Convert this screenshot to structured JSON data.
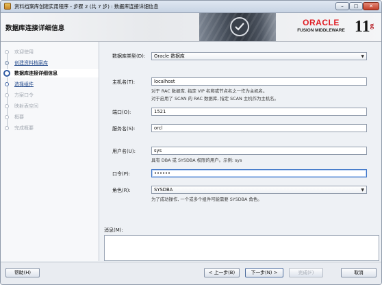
{
  "window": {
    "title": "资料档案库创建实用程序 - 步骤 2 (共 7 步) : 数据库连接详细信息",
    "controls": {
      "minimize": "–",
      "maximize": "□",
      "close": "✕"
    }
  },
  "header": {
    "page_title": "数据库连接详细信息",
    "brand": {
      "oracle": "ORACLE",
      "product": "FUSION MIDDLEWARE",
      "version": "11",
      "version_suffix": "g"
    }
  },
  "steps": [
    {
      "label": "欢迎使用",
      "state": "inactive"
    },
    {
      "label": "创建资料档案库",
      "state": "done"
    },
    {
      "label": "数据库连接详细信息",
      "state": "current"
    },
    {
      "label": "选择组件",
      "state": "next"
    },
    {
      "label": "方案口令",
      "state": "inactive"
    },
    {
      "label": "映射表空间",
      "state": "inactive"
    },
    {
      "label": "概要",
      "state": "inactive"
    },
    {
      "label": "完成概要",
      "state": "inactive"
    }
  ],
  "form": {
    "db_type": {
      "label": "数据库类型(D):",
      "value": "Oracle 数据库"
    },
    "host": {
      "label": "主机名(T):",
      "value": "localhost",
      "hint1": "对于 RAC 数据库, 指定 VIP 名称或节点名之一作为主机名。",
      "hint2": "对于启用了 SCAN 的 RAC 数据库, 指定 SCAN 主机作为主机名。"
    },
    "port": {
      "label": "端口(O):",
      "value": "1521"
    },
    "service": {
      "label": "服务名(S):",
      "value": "orcl"
    },
    "username": {
      "label": "用户名(U):",
      "value": "sys",
      "hint": "具有 DBA 或 SYSDBA 权限的用户。示例: sys"
    },
    "password": {
      "label": "口令(P):",
      "value": "••••••"
    },
    "role": {
      "label": "角色(R):",
      "value": "SYSDBA",
      "hint": "为了成功操作, 一个或多个组件可能需要 SYSDBA 角色。"
    }
  },
  "messages": {
    "label": "消息(M):"
  },
  "buttons": {
    "help": "帮助(H)",
    "back": "< 上一步(B)",
    "next": "下一步(N) >",
    "finish": "完成(F)",
    "cancel": "取消"
  },
  "icons": {
    "dropdown": "▼"
  }
}
